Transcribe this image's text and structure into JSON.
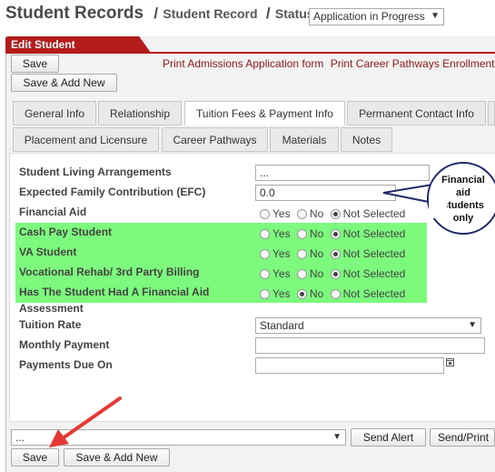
{
  "breadcrumb": {
    "title": "Student Records",
    "sep1": "/",
    "record": "Student Record",
    "sep2": "/",
    "status_label": "Status",
    "status_value": "Application in Progress"
  },
  "panel": {
    "title": "Edit Student",
    "save": "Save",
    "save_add_new": "Save & Add New",
    "link_admissions": "Print Admissions Application form",
    "link_career": "Print Career Pathways Enrollment"
  },
  "tabs": {
    "row1": [
      "General Info",
      "Relationship",
      "Tuition Fees & Payment Info",
      "Permanent Contact Info"
    ],
    "row2": [
      "Placement and Licensure",
      "Career Pathways",
      "Materials",
      "Notes"
    ],
    "active": "Tuition Fees & Payment Info"
  },
  "form": {
    "living_label": "Student Living Arrangements",
    "living_value": "...",
    "efc_label": "Expected Family Contribution (EFC)",
    "efc_value": "0.0",
    "financial_aid_label": "Financial Aid",
    "cash_pay_label": "Cash Pay Student",
    "va_label": "VA Student",
    "voc_label": "Vocational Rehab/ 3rd Party Billing",
    "had_aid_label": "Has The Student Had A Financial Aid",
    "assessment_label": "Assessment",
    "tuition_rate_label": "Tuition Rate",
    "tuition_rate_value": "Standard",
    "monthly_payment_label": "Monthly Payment",
    "monthly_payment_value": "",
    "payments_due_label": "Payments Due On",
    "payments_due_value": "",
    "radio_yes": "Yes",
    "radio_no": "No",
    "radio_not_selected": "Not Selected"
  },
  "callout": {
    "line1": "Financial",
    "line2": "aid",
    "line3": "students",
    "line4": "only"
  },
  "footer": {
    "template_select": "...",
    "send_alert": "Send Alert",
    "send_print": "Send/Print",
    "save": "Save",
    "save_add_new": "Save & Add New"
  },
  "colors": {
    "accent": "#b31b1b",
    "highlight": "#7dfa7d",
    "callout_border": "#1f2a6b",
    "arrow": "#e53935"
  }
}
